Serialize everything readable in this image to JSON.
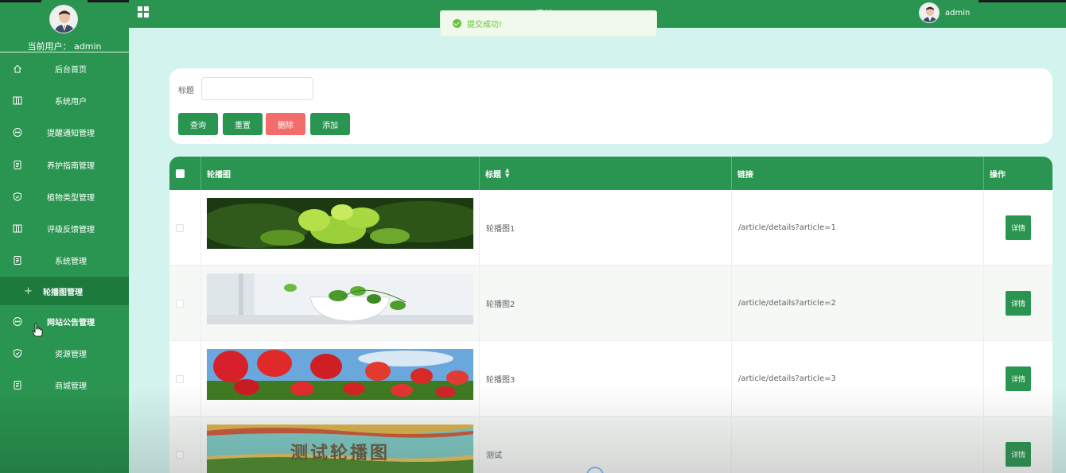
{
  "header": {
    "title": "系统",
    "user": "admin"
  },
  "sidebar": {
    "current_user_label": "当前用户：  admin",
    "items": [
      {
        "label": "后台首页",
        "icon": "home-icon"
      },
      {
        "label": "系统用户",
        "icon": "columns-icon"
      },
      {
        "label": "提醒通知管理",
        "icon": "chat-icon"
      },
      {
        "label": "养护指南管理",
        "icon": "document-icon"
      },
      {
        "label": "植物类型管理",
        "icon": "shield-icon"
      },
      {
        "label": "评级反馈管理",
        "icon": "columns-icon"
      },
      {
        "label": "系统管理",
        "icon": "document-icon"
      }
    ],
    "submenu": {
      "label": "轮播图管理"
    },
    "items_after": [
      {
        "label": "网站公告管理",
        "icon": "chat-icon"
      },
      {
        "label": "资源管理",
        "icon": "shield-icon"
      },
      {
        "label": "商城管理",
        "icon": "document-icon"
      }
    ]
  },
  "toast": {
    "text": "提交成功!"
  },
  "search": {
    "title_label": "标题",
    "title_value": "",
    "buttons": {
      "query": "查询",
      "reset": "重置",
      "delete": "删除",
      "add": "添加"
    }
  },
  "table": {
    "headers": {
      "image": "轮播图",
      "title": "标题",
      "link": "链接",
      "actions": "操作"
    },
    "rows": [
      {
        "title": "轮播图1",
        "link": "/article/details?article=1",
        "action": "详情"
      },
      {
        "title": "轮播图2",
        "link": "/article/details?article=2",
        "action": "详情"
      },
      {
        "title": "轮播图3",
        "link": "/article/details?article=3",
        "action": "详情"
      },
      {
        "title": "测试",
        "link": "",
        "action": "详情",
        "image_text": "测试轮播图"
      }
    ]
  },
  "colors": {
    "primary": "#2a9550",
    "danger": "#f36c6c",
    "background": "#d3f3ee"
  }
}
